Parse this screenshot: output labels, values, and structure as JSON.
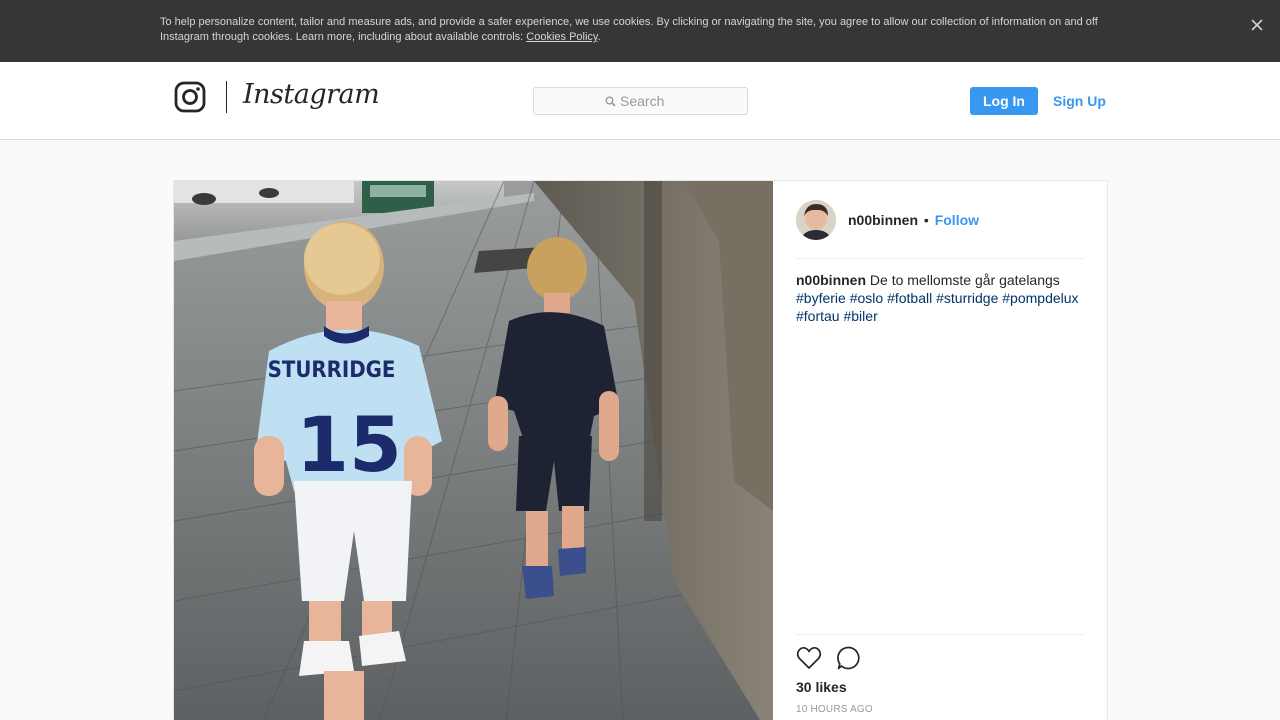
{
  "cookie_banner": {
    "text": "To help personalize content, tailor and measure ads, and provide a safer experience, we use cookies. By clicking or navigating the site, you agree to allow our collection of information on and off Instagram through cookies. Learn more, including about available controls: ",
    "link_label": "Cookies Policy",
    "trailing": ".",
    "close_icon": "close-icon"
  },
  "header": {
    "logo_glyph": "instagram-camera-icon",
    "wordmark": "Instagram",
    "search": {
      "placeholder": "Search",
      "icon": "search-icon"
    },
    "login_label": "Log In",
    "signup_label": "Sign Up"
  },
  "post": {
    "username": "n00binnen",
    "separator": "•",
    "follow_label": "Follow",
    "caption_user": "n00binnen",
    "caption_text": "De to mellomste går gatelangs",
    "hashtags": [
      "#byferie",
      "#oslo",
      "#fotball",
      "#sturridge",
      "#pompdelux",
      "#fortau",
      "#biler"
    ],
    "jersey_name": "STURRIDGE",
    "jersey_number": "15",
    "likes": "30 likes",
    "timestamp": "10 HOURS AGO",
    "icons": {
      "like": "heart-icon",
      "comment": "comment-icon"
    }
  },
  "colors": {
    "accent": "#3897f0",
    "hashtag": "#003569",
    "banner_bg": "#363636",
    "page_bg": "#fafafa"
  }
}
